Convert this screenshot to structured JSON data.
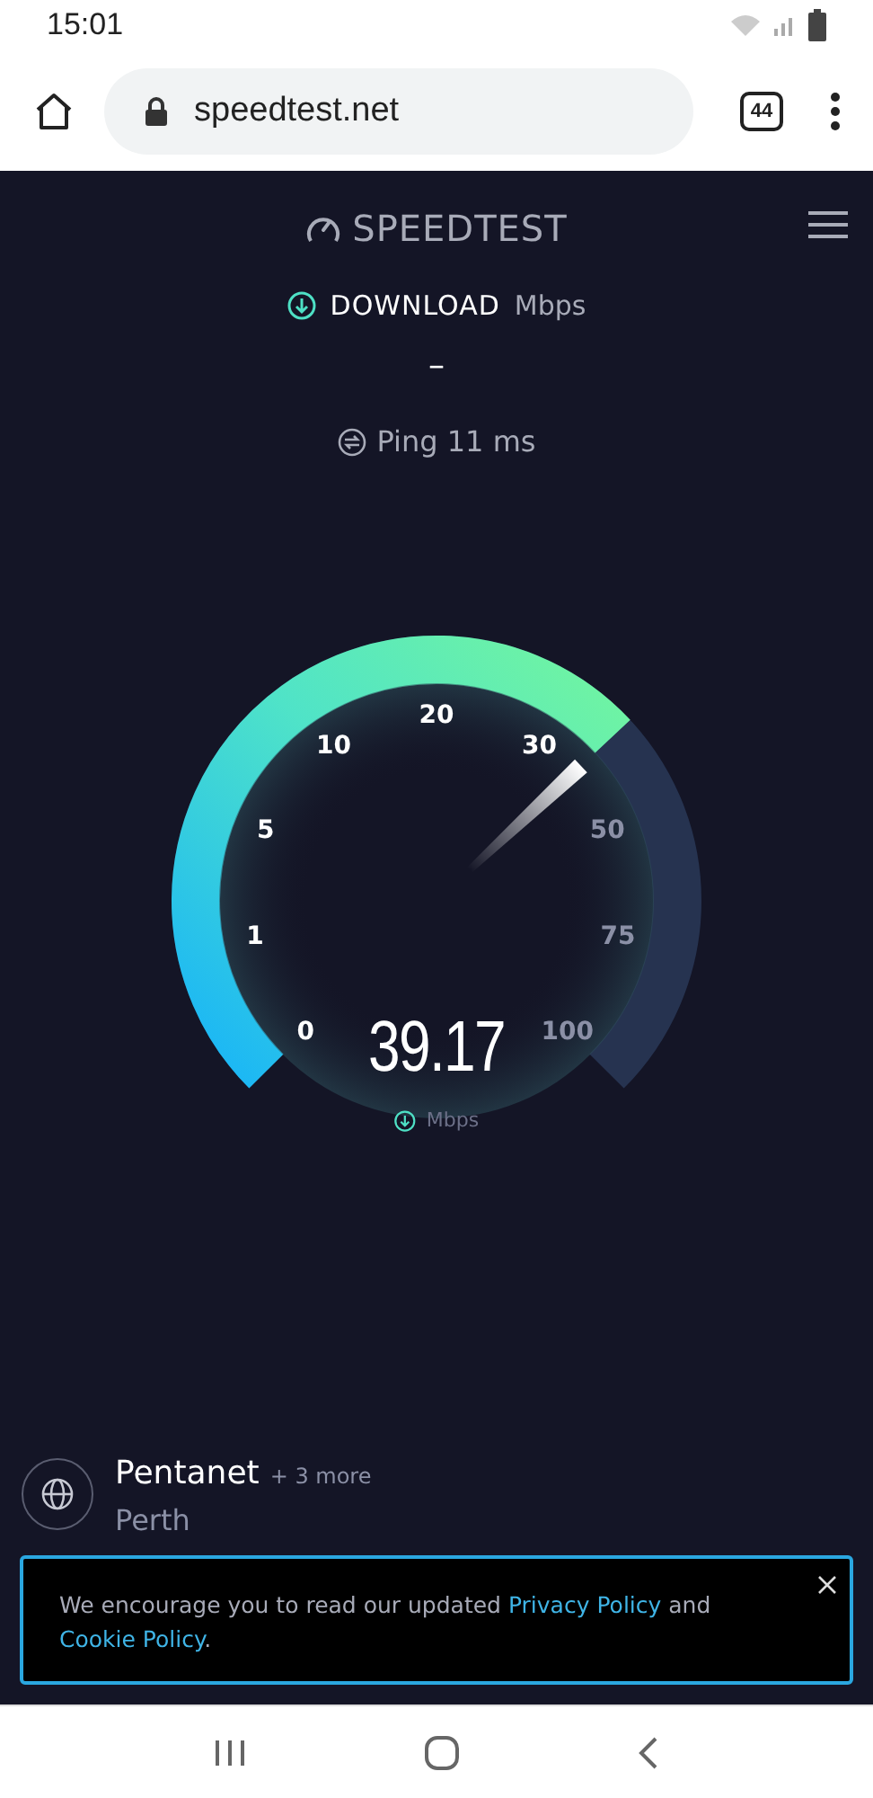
{
  "status_bar": {
    "time": "15:01"
  },
  "browser": {
    "url": "speedtest.net",
    "tab_count": "44"
  },
  "header": {
    "logo": "SPEEDTEST"
  },
  "download": {
    "label": "DOWNLOAD",
    "unit": "Mbps",
    "value": "–"
  },
  "ping": {
    "text": "Ping 11 ms"
  },
  "gauge": {
    "reading": "39.17",
    "unit": "Mbps",
    "ticks": [
      {
        "label": "0",
        "passed": true
      },
      {
        "label": "1",
        "passed": true
      },
      {
        "label": "5",
        "passed": true
      },
      {
        "label": "10",
        "passed": true
      },
      {
        "label": "20",
        "passed": true
      },
      {
        "label": "30",
        "passed": true
      },
      {
        "label": "50",
        "passed": false
      },
      {
        "label": "75",
        "passed": false
      },
      {
        "label": "100",
        "passed": false
      }
    ]
  },
  "server": {
    "name": "Pentanet",
    "more": "+ 3 more",
    "location": "Perth"
  },
  "notice": {
    "parts": [
      {
        "kind": "text",
        "text": "We encourage you to read our updated "
      },
      {
        "kind": "link",
        "text": "Privacy Policy"
      },
      {
        "kind": "text",
        "text": " and "
      },
      {
        "kind": "link",
        "text": "Cookie Policy"
      },
      {
        "kind": "text",
        "text": "."
      }
    ]
  }
}
